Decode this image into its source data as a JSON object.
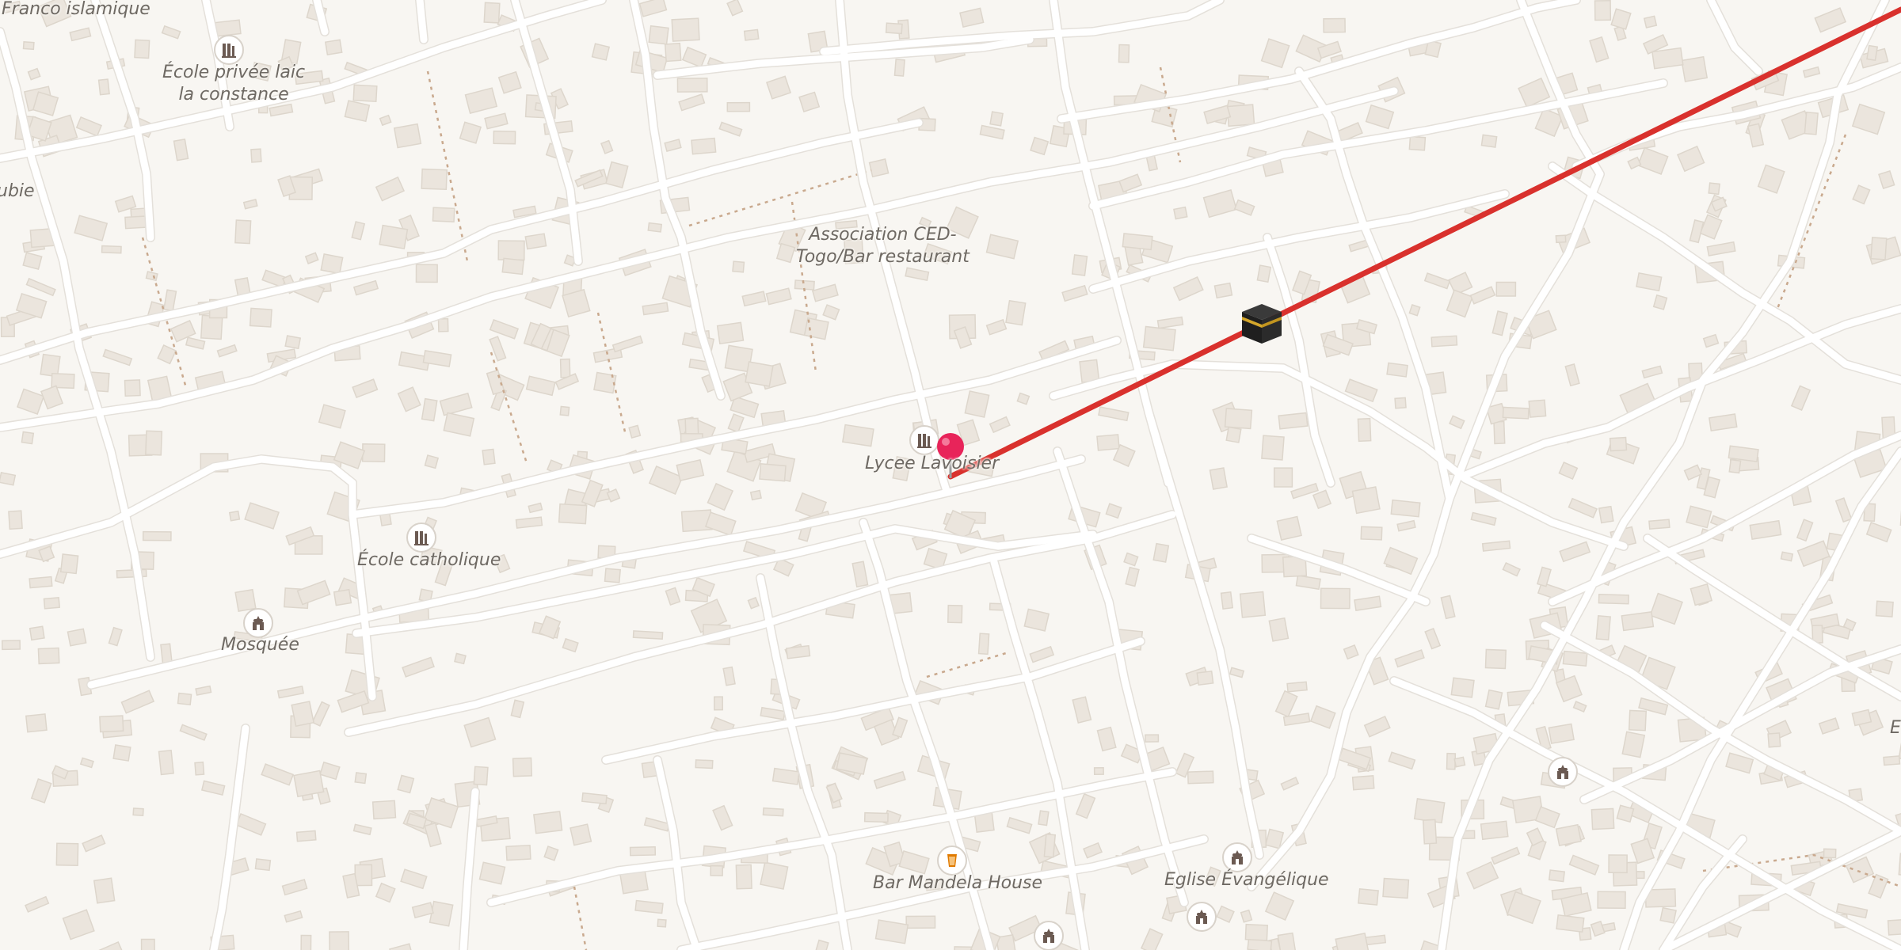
{
  "map": {
    "labels": {
      "franco_islamique": "Franco islamique",
      "ecole_privee": "École privée laic\nla constance",
      "bie": "ubie",
      "association": "Association CED-\nTogo/Bar restaurant",
      "lycee": "Lycee Lavoisier",
      "ecole_catholique": "École catholique",
      "mosquee": "Mosquée",
      "bar_mandela": "Bar Mandela House",
      "eglise": "Eglise Évangélique",
      "edge_e": "E"
    },
    "icons": {
      "school": "school-icon",
      "mosque": "place-of-worship-icon",
      "bar": "bar-icon",
      "pin": "location-pin-icon",
      "kaaba": "kaaba-icon"
    },
    "colors": {
      "background": "#f8f6f2",
      "road": "#ffffff",
      "building": "#ebe5dd",
      "qibla_line": "#d9312d",
      "pin": "#e8245a",
      "poi_icon": "#6b5a52",
      "bar_icon": "#e07a00"
    }
  }
}
